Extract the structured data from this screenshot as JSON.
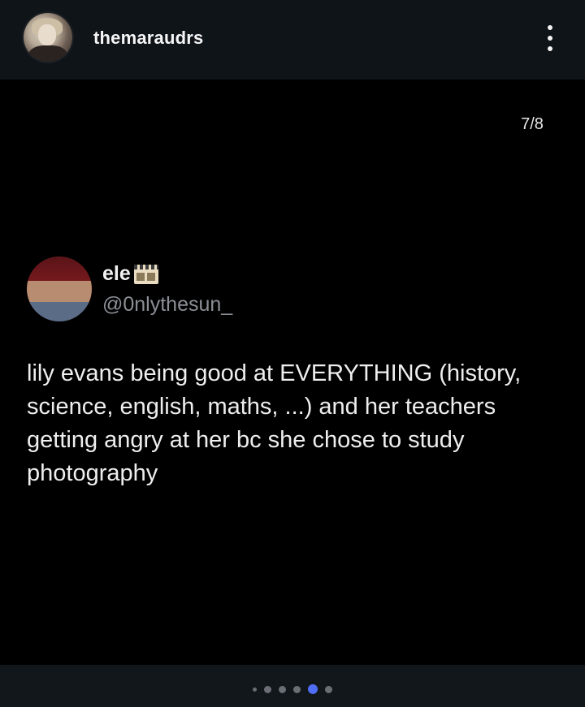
{
  "post": {
    "username": "themaraudrs",
    "avatar_icon": "profile-avatar",
    "more_icon": "more-vertical-icon"
  },
  "carousel": {
    "counter": "7/8",
    "active_index": 7,
    "total": 8,
    "active_color": "#4f6df5"
  },
  "tweet": {
    "display_name": "ele",
    "name_emoji": "film-frames-icon",
    "handle": "@0nlythesun_",
    "text": "lily evans being good at EVERYTHING (history, science, english, maths, ...) and her teachers getting angry at her bc she chose to study photography"
  }
}
